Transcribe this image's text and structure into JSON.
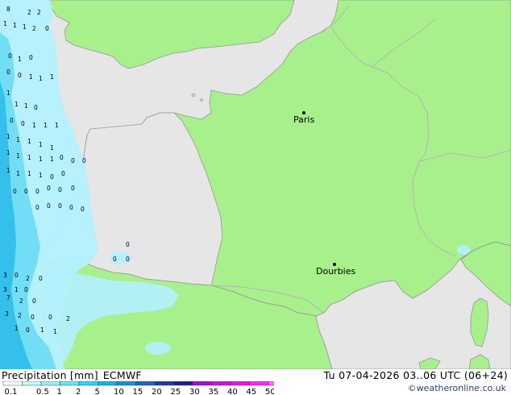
{
  "title": {
    "label": "Precipitation [mm]",
    "model": "ECMWF",
    "valid_time": "Tu 07-04-2026 03..06 UTC (06+24)",
    "credit": "©weatheronline.co.uk"
  },
  "cities": [
    {
      "name": "Paris"
    },
    {
      "name": "Dourbies"
    }
  ],
  "legend": {
    "ticks": [
      "0.1",
      "0.5",
      "1",
      "2",
      "5",
      "10",
      "15",
      "20",
      "25",
      "30",
      "35",
      "40",
      "45",
      "50"
    ],
    "colors": [
      "#ffffff",
      "#c8f8ff",
      "#96f0ff",
      "#64e4ff",
      "#32d2f5",
      "#14b4e6",
      "#1e8cd2",
      "#1e64be",
      "#1e3ca0",
      "#1e1e8c",
      "#a014c8",
      "#c814dc",
      "#e614e6",
      "#ff28f0",
      "#ff64ff"
    ]
  },
  "colors": {
    "sea": "#e6e6e6",
    "land": "#a8f08c",
    "border": "#b4b4b4",
    "coast": "#969696",
    "rain_light": "#b4f0ff",
    "rain_medium": "#6edcf5",
    "rain_heavy": "#32beeb"
  },
  "rain_values": [
    "8",
    "2",
    "2",
    "1",
    "1",
    "1",
    "2",
    "0",
    "0",
    "1",
    "0",
    "0",
    "0",
    "1",
    "1",
    "1",
    "1",
    "1",
    "1",
    "0",
    "0",
    "0",
    "1",
    "1",
    "1",
    "1",
    "1",
    "1",
    "1",
    "1",
    "1",
    "1",
    "1",
    "1",
    "1",
    "1",
    "1",
    "1",
    "1",
    "0",
    "0",
    "0",
    "0",
    "0",
    "0",
    "0",
    "0",
    "0",
    "0",
    "0",
    "0",
    "0",
    "0",
    "0",
    "0",
    "0",
    "0",
    "0",
    "3",
    "0",
    "2",
    "0",
    "3",
    "1",
    "0",
    "7",
    "2",
    "0",
    "3",
    "2",
    "0",
    "0",
    "2",
    "1",
    "0",
    "1",
    "1"
  ]
}
